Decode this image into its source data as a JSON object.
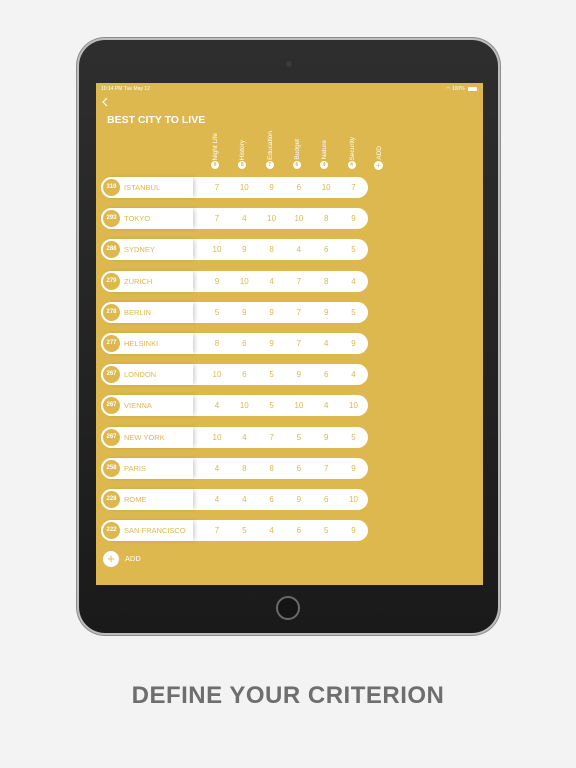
{
  "status": {
    "time": "10:14 PM",
    "date": "Tue May 12",
    "battery": "100%"
  },
  "app": {
    "title": "BEST CITY TO LIVE",
    "add_label": "ADD"
  },
  "criteria": [
    {
      "label": "Night Life",
      "weight": "9"
    },
    {
      "label": "History",
      "weight": "8"
    },
    {
      "label": "Education",
      "weight": "7"
    },
    {
      "label": "Budget",
      "weight": "6"
    },
    {
      "label": "Nature",
      "weight": "4"
    },
    {
      "label": "Security",
      "weight": "4"
    }
  ],
  "add_criterion_label": "ADD",
  "cities": [
    {
      "score": "310",
      "name": "ISTANBUL",
      "values": [
        "7",
        "10",
        "9",
        "6",
        "10",
        "7"
      ]
    },
    {
      "score": "293",
      "name": "TOKYO",
      "values": [
        "7",
        "4",
        "10",
        "10",
        "8",
        "9"
      ]
    },
    {
      "score": "288",
      "name": "SYDNEY",
      "values": [
        "10",
        "9",
        "8",
        "4",
        "6",
        "5"
      ]
    },
    {
      "score": "279",
      "name": "ZURICH",
      "values": [
        "9",
        "10",
        "4",
        "7",
        "8",
        "4"
      ]
    },
    {
      "score": "278",
      "name": "BERLIN",
      "values": [
        "5",
        "9",
        "9",
        "7",
        "9",
        "5"
      ]
    },
    {
      "score": "277",
      "name": "HELSINKI",
      "values": [
        "8",
        "6",
        "9",
        "7",
        "4",
        "9"
      ]
    },
    {
      "score": "267",
      "name": "LONDON",
      "values": [
        "10",
        "6",
        "5",
        "9",
        "6",
        "4"
      ]
    },
    {
      "score": "267",
      "name": "VIENNA",
      "values": [
        "4",
        "10",
        "5",
        "10",
        "4",
        "10"
      ]
    },
    {
      "score": "267",
      "name": "NEW YORK",
      "values": [
        "10",
        "4",
        "7",
        "5",
        "9",
        "5"
      ]
    },
    {
      "score": "258",
      "name": "PARIS",
      "values": [
        "4",
        "8",
        "8",
        "6",
        "7",
        "9"
      ]
    },
    {
      "score": "228",
      "name": "ROME",
      "values": [
        "4",
        "4",
        "6",
        "9",
        "6",
        "10"
      ]
    },
    {
      "score": "222",
      "name": "SAN FRANCISCO",
      "values": [
        "7",
        "5",
        "4",
        "6",
        "5",
        "9"
      ]
    }
  ],
  "caption": "DEFINE YOUR CRITERION",
  "colors": {
    "accent": "#dcb84f",
    "background": "#f3f3f3",
    "caption": "#6e6e6e"
  },
  "icons": {
    "back": "chevron-left-icon",
    "add": "plus-icon",
    "wifi": "wifi-icon",
    "battery": "battery-icon"
  }
}
